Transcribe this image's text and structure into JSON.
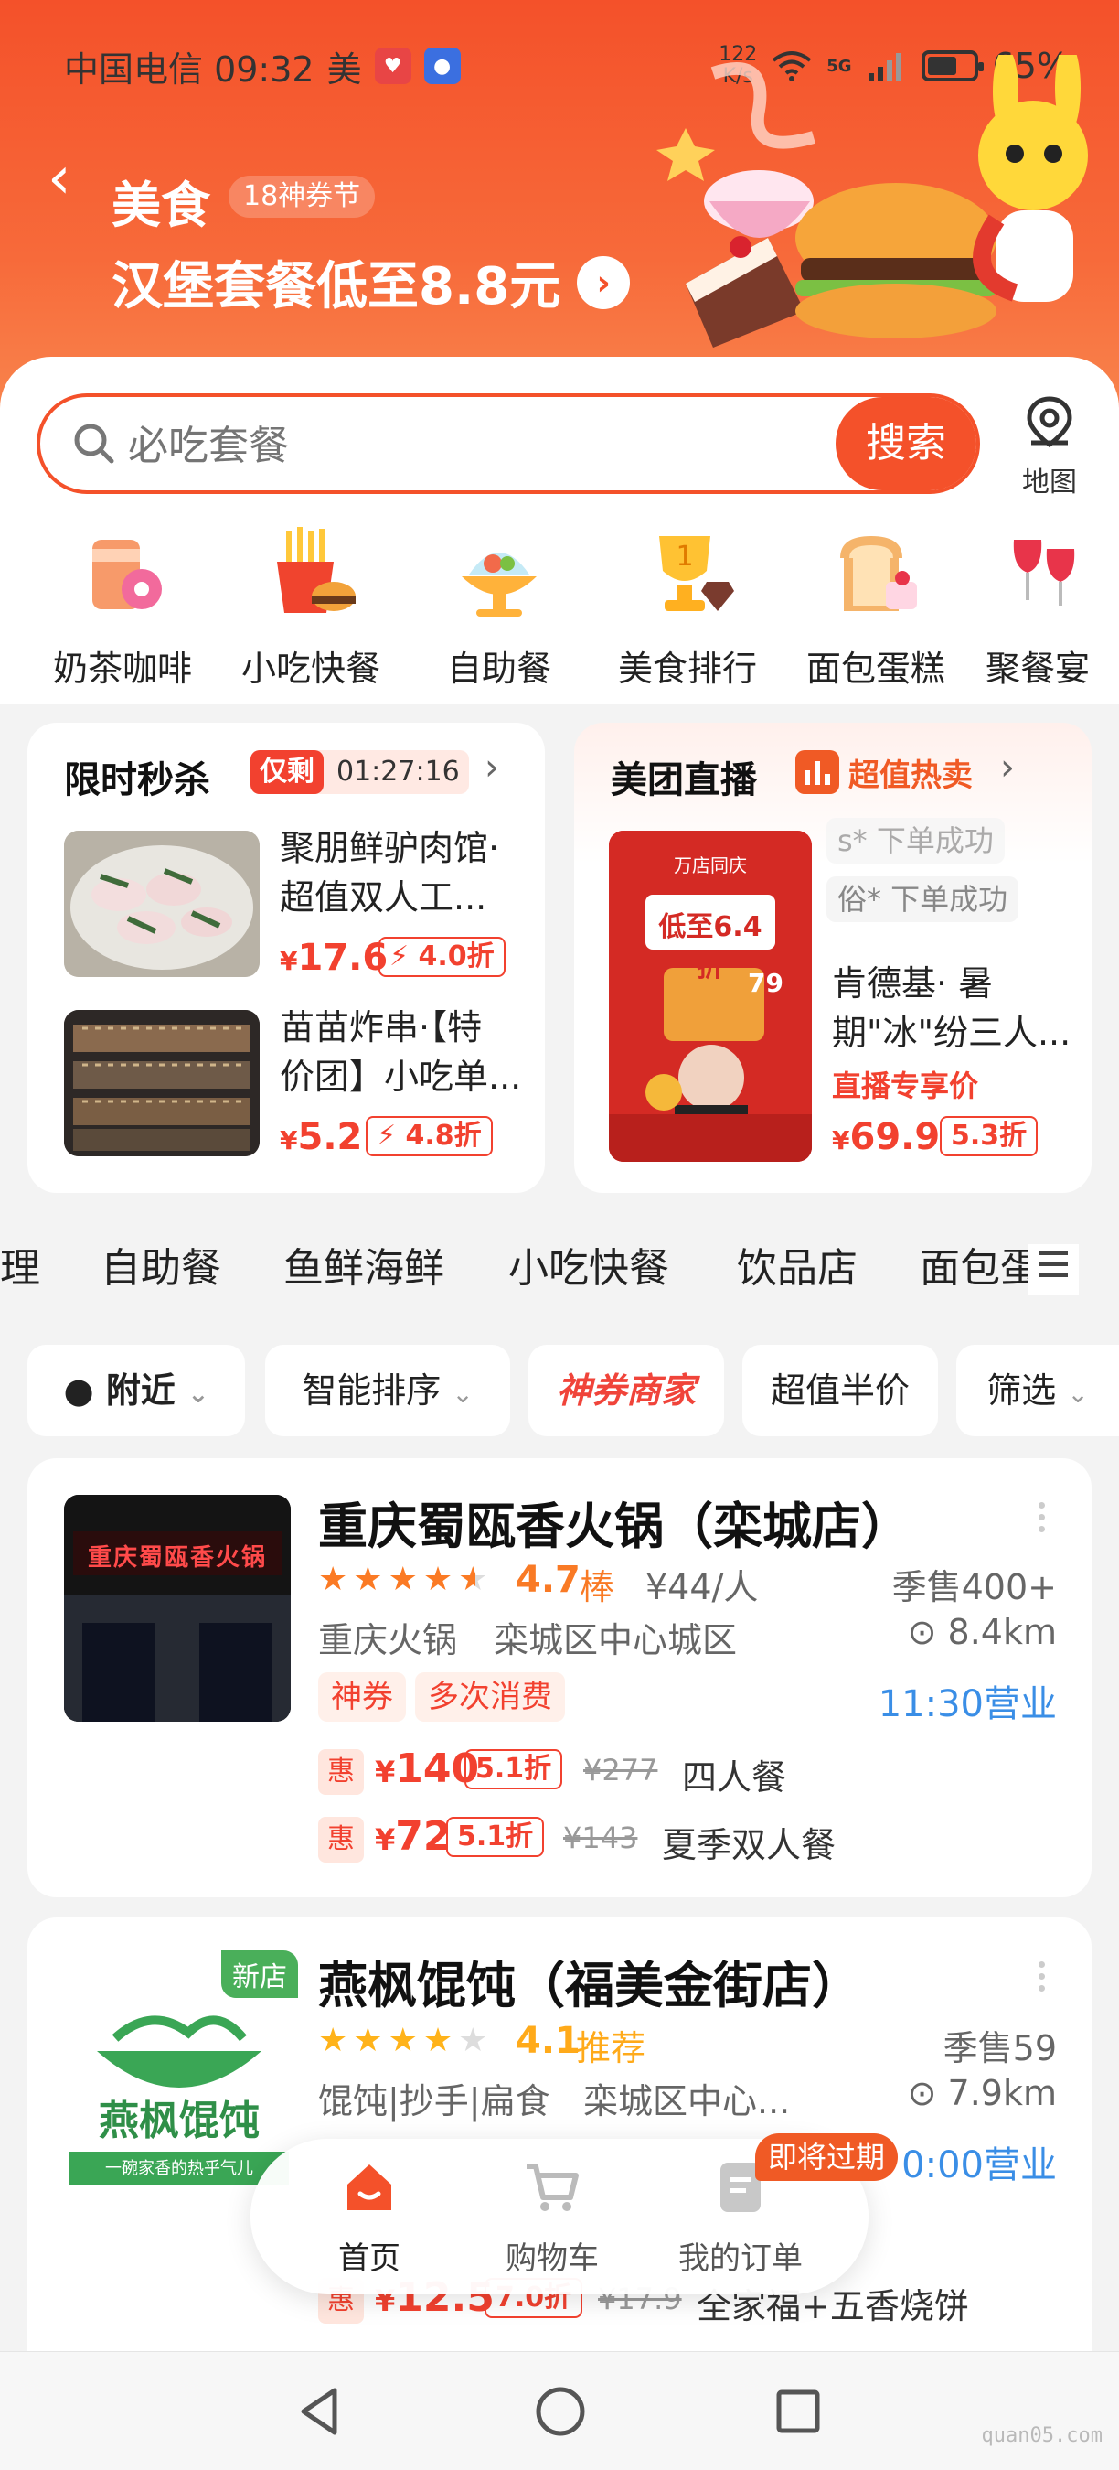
{
  "status_bar": {
    "carrier_time": "中国电信 09:32",
    "app_badge": "美",
    "net_speed_value": "122",
    "net_speed_unit": "K/s",
    "signal": "5G",
    "battery": "65%",
    "battery_level": 0.65
  },
  "header": {
    "title": "美食",
    "tag": "18神券节",
    "promo": "汉堡套餐低至8.8元"
  },
  "search": {
    "placeholder": "必吃套餐",
    "button": "搜索",
    "map_label": "地图"
  },
  "categories": [
    {
      "label": "奶茶咖啡",
      "icon": "milk-tea-icon"
    },
    {
      "label": "小吃快餐",
      "icon": "fast-food-icon"
    },
    {
      "label": "自助餐",
      "icon": "buffet-icon"
    },
    {
      "label": "美食排行",
      "icon": "trophy-icon"
    },
    {
      "label": "面包蛋糕",
      "icon": "bread-cake-icon"
    },
    {
      "label": "聚餐宴",
      "icon": "wine-glasses-icon"
    }
  ],
  "flash_sale": {
    "title": "限时秒杀",
    "remaining_label": "仅剩",
    "timer": "01:27:16",
    "items": [
      {
        "name_line1": "聚朋鲜驴肉馆·",
        "name_line2": "超值双人工...",
        "price": "17.6",
        "discount": "4.0折"
      },
      {
        "name_line1": "苗苗炸串·【特",
        "name_line2": "价团】小吃单...",
        "price": "5.2",
        "discount": "4.8折"
      }
    ]
  },
  "live": {
    "title": "美团直播",
    "badge": "超值热卖",
    "ticker1": "s* 下单成功",
    "ticker2": "俗* 下单成功",
    "name_line1": "肯德基· 暑",
    "name_line2": "期\"冰\"纷三人...",
    "note": "直播专享价",
    "price": "69.9",
    "discount": "5.3折",
    "poster_text": "低至6.4折",
    "poster_price": "79",
    "poster_brand": "万店同庆"
  },
  "tabs": [
    "理",
    "自助餐",
    "鱼鲜海鲜",
    "小吃快餐",
    "饮品店",
    "面包蛋"
  ],
  "filters": {
    "nearby": "附近",
    "sort": "智能排序",
    "god_coupon": "神券商家",
    "half_price": "超值半价",
    "filter": "筛选"
  },
  "shops": [
    {
      "name": "重庆蜀瓯香火锅（栾城店）",
      "sign_text": "重庆蜀瓯香火锅",
      "rating": "4.7",
      "rating_tag": "棒",
      "avg_price": "¥44/人",
      "sales": "季售400+",
      "cuisine": "重庆火锅",
      "area": "栾城区中心城区",
      "distance": "8.4km",
      "labels": [
        "神券",
        "多次消费"
      ],
      "hours": "11:30营业",
      "deals": [
        {
          "tag": "惠",
          "price": "140",
          "discount": "5.1折",
          "original": "¥277",
          "desc": "四人餐"
        },
        {
          "tag": "惠",
          "price": "72",
          "discount": "5.1折",
          "original": "¥143",
          "desc": "夏季双人餐"
        }
      ]
    },
    {
      "name": "燕枫馄饨（福美金街店）",
      "logo_text": "燕枫馄饨",
      "logo_slogan": "一碗家香的热乎气儿",
      "new_badge": "新店",
      "rating": "4.1",
      "rating_tag": "推荐",
      "sales": "季售59",
      "cuisine": "馄饨|抄手|扁食",
      "area": "栾城区中心...",
      "distance": "7.9km",
      "hours": "0:00营业",
      "deals": [
        {
          "tag": "惠",
          "price": "12.5",
          "discount": "7.0折",
          "original": "¥17.9",
          "desc": "全家福+五香烧饼"
        }
      ]
    }
  ],
  "bottom_tabs": {
    "home": "首页",
    "cart": "购物车",
    "orders": "我的订单",
    "expire_badge": "即将过期"
  },
  "watermark": "quan05.com",
  "colors": {
    "brand": "#f4512a",
    "price": "#f2412f",
    "rating": "#f97a25",
    "link": "#3a8ee6"
  }
}
